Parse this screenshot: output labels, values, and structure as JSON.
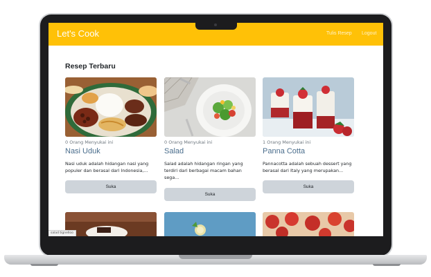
{
  "navbar": {
    "brand": "Let's Cook",
    "links": [
      "Tulis Resep",
      "Logout"
    ],
    "color": "#ffc107"
  },
  "section_title": "Resep Terbaru",
  "recipes": [
    {
      "likes": "0 Orang Menyukai ini",
      "title": "Nasi Uduk",
      "description": "Nasi uduk adalah hidangan nasi yang populer dan berasal dari Indonesia,...",
      "button": "Suka"
    },
    {
      "likes": "0 Orang Menyukai ini",
      "title": "Salad",
      "description": "Salad adalah hidangan ringan yang terdiri dari berbagai macam bahan sega...",
      "button": "Suka"
    },
    {
      "likes": "1 Orang Menyukai ini",
      "title": "Panna Cotta",
      "description": "Pannacotta adalah sebuah dessert yang berasal dari Italy yang merupakan...",
      "button": "Suka"
    }
  ],
  "status_bar": "salad tignelloo",
  "colors": {
    "accent": "#ffc107",
    "title_link": "#4a6d8c",
    "button": "#ced4da"
  }
}
